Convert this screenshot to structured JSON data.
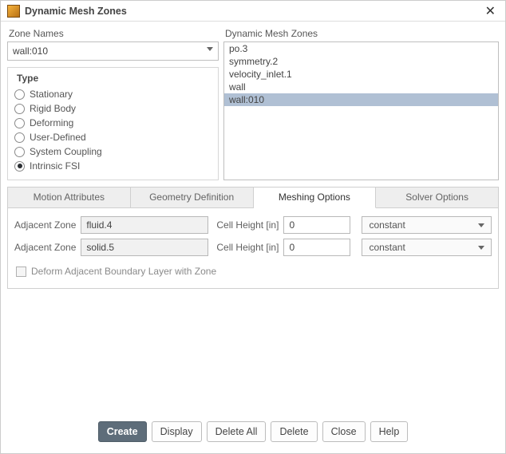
{
  "window": {
    "title": "Dynamic Mesh Zones"
  },
  "zone_names": {
    "label": "Zone Names",
    "selected": "wall:010"
  },
  "type_group": {
    "title": "Type",
    "options": [
      {
        "label": "Stationary",
        "selected": false
      },
      {
        "label": "Rigid Body",
        "selected": false
      },
      {
        "label": "Deforming",
        "selected": false
      },
      {
        "label": "User-Defined",
        "selected": false
      },
      {
        "label": "System Coupling",
        "selected": false
      },
      {
        "label": "Intrinsic FSI",
        "selected": true
      }
    ]
  },
  "dmz_list": {
    "label": "Dynamic Mesh Zones",
    "items": [
      {
        "label": "po.3",
        "selected": false
      },
      {
        "label": "symmetry.2",
        "selected": false
      },
      {
        "label": "velocity_inlet.1",
        "selected": false
      },
      {
        "label": "wall",
        "selected": false
      },
      {
        "label": "wall:010",
        "selected": true
      }
    ]
  },
  "tabs": [
    {
      "label": "Motion Attributes",
      "active": false
    },
    {
      "label": "Geometry Definition",
      "active": false
    },
    {
      "label": "Meshing Options",
      "active": true
    },
    {
      "label": "Solver Options",
      "active": false
    }
  ],
  "meshing": {
    "rows": [
      {
        "adj_label": "Adjacent Zone",
        "adj_value": "fluid.4",
        "cellh_label": "Cell Height [in]",
        "cellh_value": "0",
        "method": "constant"
      },
      {
        "adj_label": "Adjacent Zone",
        "adj_value": "solid.5",
        "cellh_label": "Cell Height [in]",
        "cellh_value": "0",
        "method": "constant"
      }
    ],
    "deform_checkbox": {
      "label": "Deform Adjacent Boundary Layer with Zone",
      "checked": false
    }
  },
  "buttons": {
    "create": "Create",
    "display": "Display",
    "delete_all": "Delete All",
    "delete": "Delete",
    "close": "Close",
    "help": "Help"
  }
}
